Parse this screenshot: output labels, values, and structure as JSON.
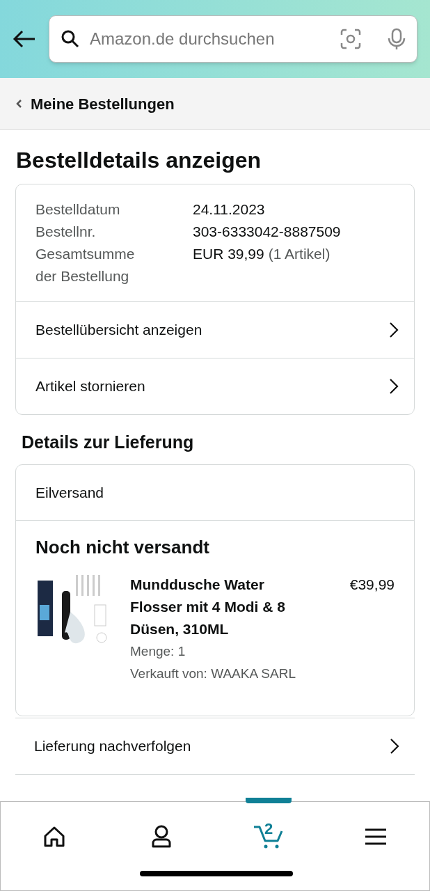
{
  "search": {
    "placeholder": "Amazon.de durchsuchen"
  },
  "breadcrumb": "Meine Bestellungen",
  "title": "Bestelldetails anzeigen",
  "order_info": [
    {
      "label": "Bestelldatum",
      "value": "24.11.2023"
    },
    {
      "label": "Bestellnr.",
      "value": "303-6333042-8887509"
    },
    {
      "label": "Gesamtsumme der Bestellung",
      "value": "EUR 39,99",
      "note": "(1 Artikel)"
    }
  ],
  "order_actions": [
    "Bestellübersicht anzeigen",
    "Artikel stornieren"
  ],
  "delivery": {
    "heading": "Details zur Lieferung",
    "method": "Eilversand",
    "status": "Noch nicht versandt",
    "item": {
      "kind": "picture",
      "title": "Munddusche Water Flosser mit 4 Modi & 8 Düsen, 310ML",
      "price": "€39,99",
      "quantity": "Menge: 1",
      "seller": "Verkauft von: WAAKA SARL"
    }
  },
  "delivery_actions": [
    "Lieferung nachverfolgen"
  ],
  "nav": [
    {
      "kind": "home",
      "selected": false
    },
    {
      "kind": "account",
      "selected": false
    },
    {
      "kind": "cart",
      "selected": true,
      "badge": "2"
    },
    {
      "kind": "menu",
      "selected": false
    }
  ]
}
